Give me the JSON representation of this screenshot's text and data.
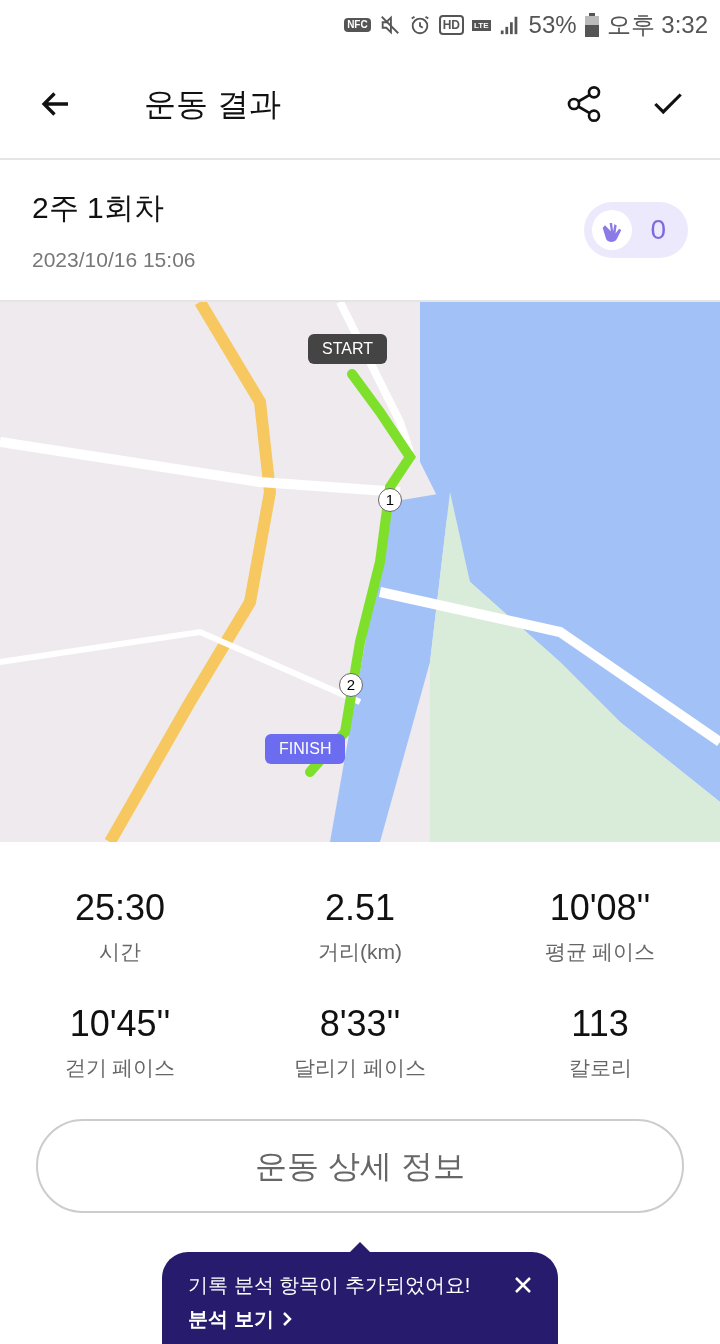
{
  "status_bar": {
    "badges": [
      {
        "kind": "nfc",
        "text": "NFC"
      },
      {
        "kind": "mute"
      },
      {
        "kind": "alarm"
      },
      {
        "kind": "hd",
        "text": "HD"
      },
      {
        "kind": "lte",
        "text": "LTE"
      },
      {
        "kind": "signal"
      }
    ],
    "battery": "53%",
    "time": "오후 3:32"
  },
  "header": {
    "title": "운동 결과"
  },
  "session": {
    "title": "2주 1회차",
    "date": "2023/10/16 15:06",
    "claps": "0"
  },
  "map": {
    "markers": [
      {
        "kind": "start",
        "text": "START"
      },
      {
        "kind": "lap",
        "text": "1"
      },
      {
        "kind": "lap",
        "text": "2"
      },
      {
        "kind": "finish",
        "text": "FINISH"
      }
    ]
  },
  "stats": [
    {
      "value": "25:30",
      "label": "시간"
    },
    {
      "value": "2.51",
      "label": "거리(km)"
    },
    {
      "value": "10'08''",
      "label": "평균 페이스"
    },
    {
      "value": "10'45''",
      "label": "걷기 페이스"
    },
    {
      "value": "8'33''",
      "label": "달리기 페이스"
    },
    {
      "value": "113",
      "label": "칼로리"
    }
  ],
  "detail_button": "운동 상세 정보",
  "toast": {
    "message": "기록 분석 항목이 추가되었어요!",
    "link": "분석 보기"
  }
}
